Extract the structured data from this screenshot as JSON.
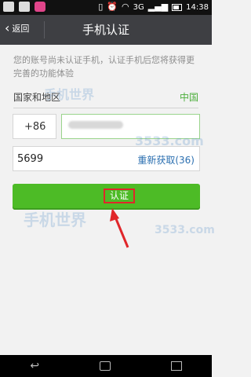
{
  "status_bar": {
    "network": "3G",
    "time": "14:38",
    "alarm_icon": "alarm-icon",
    "wifi_icon": "wifi-icon",
    "signal_icon": "signal-icon"
  },
  "header": {
    "back_label": "返回",
    "title": "手机认证"
  },
  "info_text": "您的账号尚未认证手机，认证手机后您将获得更完善的功能体验",
  "country": {
    "label": "国家和地区",
    "value": "中国"
  },
  "phone": {
    "code": "+86"
  },
  "sms": {
    "value": "5699",
    "resend_label": "重新获取(36)"
  },
  "verify_button": {
    "label": "认证",
    "color": "#4dbb26"
  },
  "watermarks": [
    "手机世界",
    "3533.com",
    "手机世界",
    "3533.com"
  ],
  "colors": {
    "accent_green": "#4cae3c",
    "link_blue": "#2b6fb0",
    "highlight_red": "#e0262a"
  }
}
